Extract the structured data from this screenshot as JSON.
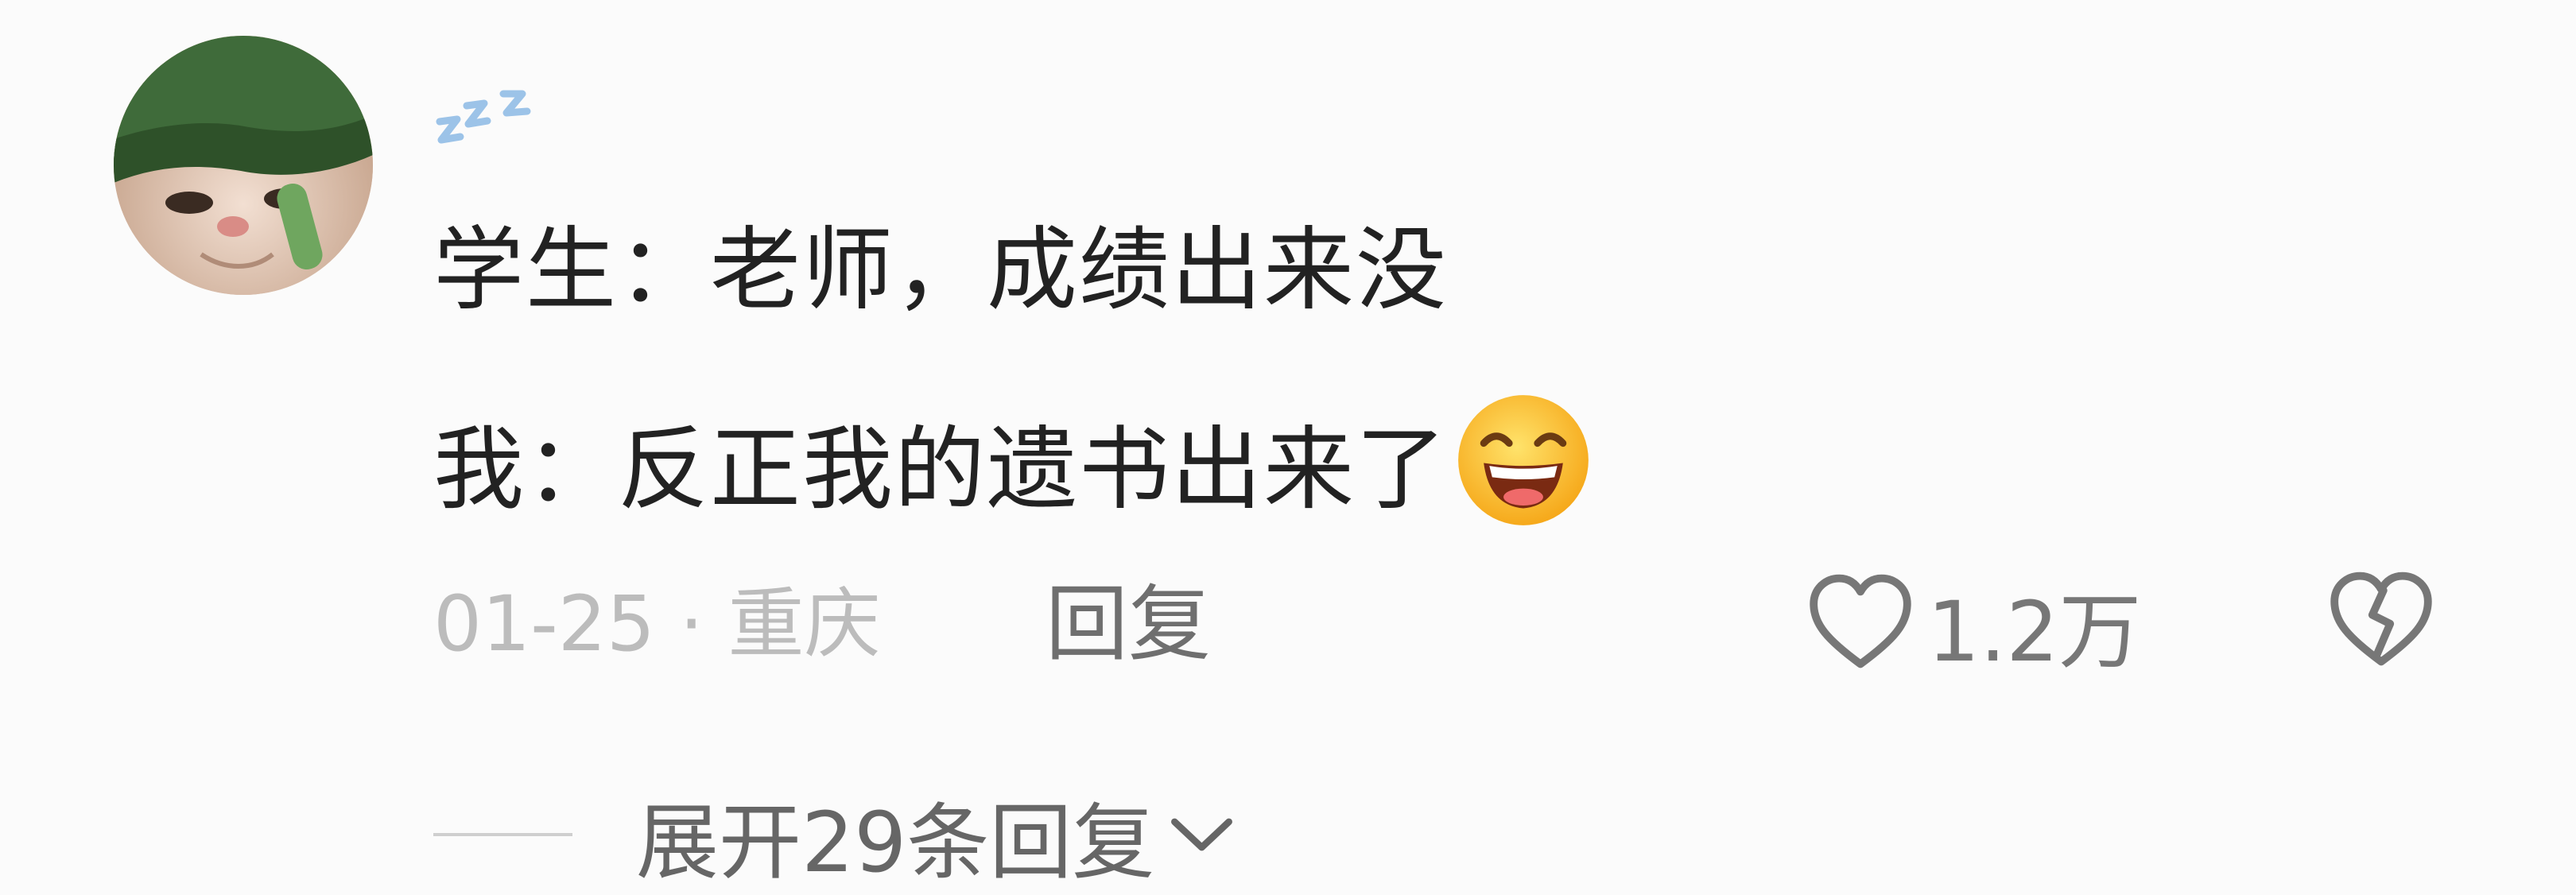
{
  "comment": {
    "avatar_icon": "cat-with-green-hat-avatar",
    "username_icon": "zzz-sleep-icon",
    "lines": [
      "学生：老师，成绩出来没",
      "我：反正我的遗书出来了"
    ],
    "emoji_icon": "grinning-squinting-face-emoji",
    "meta": "01-25 · 重庆",
    "reply_label": "回复",
    "like_icon": "heart-outline-icon",
    "like_count": "1.2万",
    "dislike_icon": "broken-heart-icon",
    "expand_label": "展开29条回复",
    "expand_icon": "chevron-down-icon"
  },
  "colors": {
    "background": "#fbfbfb",
    "text": "#222222",
    "meta": "#bcbcbc",
    "secondary": "#6f6f6f",
    "username_accent": "#9cc3e8"
  }
}
